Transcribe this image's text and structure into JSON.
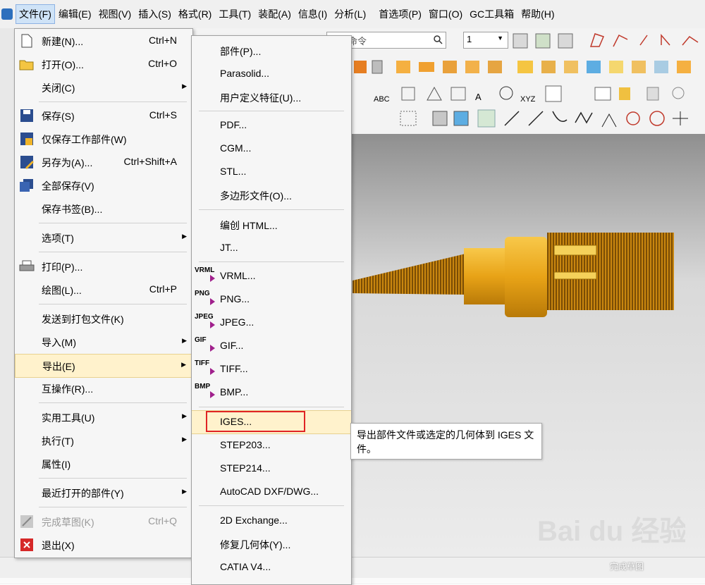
{
  "menubar": {
    "items": [
      "文件(F)",
      "编辑(E)",
      "视图(V)",
      "插入(S)",
      "格式(R)",
      "工具(T)",
      "装配(A)",
      "信息(I)",
      "分析(L)",
      "首选项(P)",
      "窗口(O)",
      "GC工具箱",
      "帮助(H)"
    ]
  },
  "toolbar": {
    "search_placeholder": "查找命令",
    "layer_value": "1",
    "text_abc": "ABC",
    "text_xyz": "XYZ"
  },
  "file_menu": {
    "items": [
      {
        "label": "新建(N)...",
        "shortcut": "Ctrl+N"
      },
      {
        "label": "打开(O)...",
        "shortcut": "Ctrl+O"
      },
      {
        "label": "关闭(C)",
        "shortcut": ""
      },
      {
        "label": "保存(S)",
        "shortcut": "Ctrl+S"
      },
      {
        "label": "仅保存工作部件(W)",
        "shortcut": ""
      },
      {
        "label": "另存为(A)...",
        "shortcut": "Ctrl+Shift+A"
      },
      {
        "label": "全部保存(V)",
        "shortcut": ""
      },
      {
        "label": "保存书签(B)...",
        "shortcut": ""
      },
      {
        "label": "选项(T)",
        "shortcut": ""
      },
      {
        "label": "打印(P)...",
        "shortcut": ""
      },
      {
        "label": "绘图(L)...",
        "shortcut": "Ctrl+P"
      },
      {
        "label": "发送到打包文件(K)",
        "shortcut": ""
      },
      {
        "label": "导入(M)",
        "shortcut": ""
      },
      {
        "label": "导出(E)",
        "shortcut": ""
      },
      {
        "label": "互操作(R)...",
        "shortcut": ""
      },
      {
        "label": "实用工具(U)",
        "shortcut": ""
      },
      {
        "label": "执行(T)",
        "shortcut": ""
      },
      {
        "label": "属性(I)",
        "shortcut": ""
      },
      {
        "label": "最近打开的部件(Y)",
        "shortcut": ""
      },
      {
        "label": "完成草图(K)",
        "shortcut": "Ctrl+Q"
      },
      {
        "label": "退出(X)",
        "shortcut": ""
      }
    ]
  },
  "export_menu": {
    "items": [
      {
        "label": "部件(P)..."
      },
      {
        "label": "Parasolid..."
      },
      {
        "label": "用户定义特征(U)..."
      },
      {
        "label": "PDF..."
      },
      {
        "label": "CGM..."
      },
      {
        "label": "STL..."
      },
      {
        "label": "多边形文件(O)..."
      },
      {
        "label": "编创 HTML..."
      },
      {
        "label": "JT..."
      },
      {
        "label": "VRML...",
        "tag": "VRML"
      },
      {
        "label": "PNG...",
        "tag": "PNG"
      },
      {
        "label": "JPEG...",
        "tag": "JPEG"
      },
      {
        "label": "GIF...",
        "tag": "GIF"
      },
      {
        "label": "TIFF...",
        "tag": "TIFF"
      },
      {
        "label": "BMP...",
        "tag": "BMP"
      },
      {
        "label": "IGES..."
      },
      {
        "label": "STEP203..."
      },
      {
        "label": "STEP214..."
      },
      {
        "label": "AutoCAD DXF/DWG..."
      },
      {
        "label": "2D Exchange..."
      },
      {
        "label": "修复几何体(Y)..."
      },
      {
        "label": "CATIA V4..."
      }
    ]
  },
  "tooltip": {
    "text": "导出部件文件或选定的几何体到 IGES 文件。"
  },
  "bottom_toolbar": {
    "finish_sketch": "完成草图"
  },
  "watermark": {
    "text": "Bai du 经验"
  },
  "colors": {
    "menu_highlight": "#fff2cc",
    "annotation_red": "#e02424",
    "part_gold": "#e8a317",
    "vrml_arrow": "#a0208c"
  }
}
